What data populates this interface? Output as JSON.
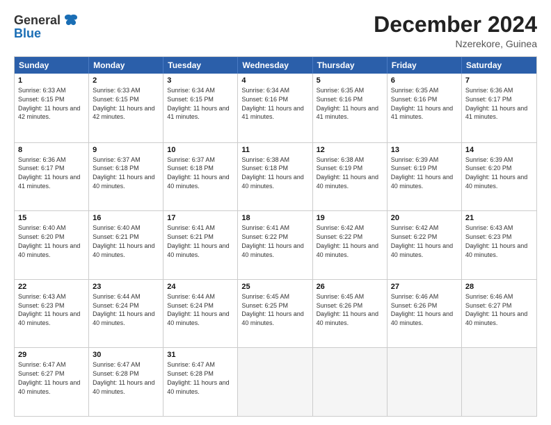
{
  "header": {
    "logo_general": "General",
    "logo_blue": "Blue",
    "month_title": "December 2024",
    "location": "Nzerekore, Guinea"
  },
  "weekdays": [
    "Sunday",
    "Monday",
    "Tuesday",
    "Wednesday",
    "Thursday",
    "Friday",
    "Saturday"
  ],
  "rows": [
    [
      {
        "day": "1",
        "sunrise": "Sunrise: 6:33 AM",
        "sunset": "Sunset: 6:15 PM",
        "daylight": "Daylight: 11 hours and 42 minutes."
      },
      {
        "day": "2",
        "sunrise": "Sunrise: 6:33 AM",
        "sunset": "Sunset: 6:15 PM",
        "daylight": "Daylight: 11 hours and 42 minutes."
      },
      {
        "day": "3",
        "sunrise": "Sunrise: 6:34 AM",
        "sunset": "Sunset: 6:15 PM",
        "daylight": "Daylight: 11 hours and 41 minutes."
      },
      {
        "day": "4",
        "sunrise": "Sunrise: 6:34 AM",
        "sunset": "Sunset: 6:16 PM",
        "daylight": "Daylight: 11 hours and 41 minutes."
      },
      {
        "day": "5",
        "sunrise": "Sunrise: 6:35 AM",
        "sunset": "Sunset: 6:16 PM",
        "daylight": "Daylight: 11 hours and 41 minutes."
      },
      {
        "day": "6",
        "sunrise": "Sunrise: 6:35 AM",
        "sunset": "Sunset: 6:16 PM",
        "daylight": "Daylight: 11 hours and 41 minutes."
      },
      {
        "day": "7",
        "sunrise": "Sunrise: 6:36 AM",
        "sunset": "Sunset: 6:17 PM",
        "daylight": "Daylight: 11 hours and 41 minutes."
      }
    ],
    [
      {
        "day": "8",
        "sunrise": "Sunrise: 6:36 AM",
        "sunset": "Sunset: 6:17 PM",
        "daylight": "Daylight: 11 hours and 41 minutes."
      },
      {
        "day": "9",
        "sunrise": "Sunrise: 6:37 AM",
        "sunset": "Sunset: 6:18 PM",
        "daylight": "Daylight: 11 hours and 40 minutes."
      },
      {
        "day": "10",
        "sunrise": "Sunrise: 6:37 AM",
        "sunset": "Sunset: 6:18 PM",
        "daylight": "Daylight: 11 hours and 40 minutes."
      },
      {
        "day": "11",
        "sunrise": "Sunrise: 6:38 AM",
        "sunset": "Sunset: 6:18 PM",
        "daylight": "Daylight: 11 hours and 40 minutes."
      },
      {
        "day": "12",
        "sunrise": "Sunrise: 6:38 AM",
        "sunset": "Sunset: 6:19 PM",
        "daylight": "Daylight: 11 hours and 40 minutes."
      },
      {
        "day": "13",
        "sunrise": "Sunrise: 6:39 AM",
        "sunset": "Sunset: 6:19 PM",
        "daylight": "Daylight: 11 hours and 40 minutes."
      },
      {
        "day": "14",
        "sunrise": "Sunrise: 6:39 AM",
        "sunset": "Sunset: 6:20 PM",
        "daylight": "Daylight: 11 hours and 40 minutes."
      }
    ],
    [
      {
        "day": "15",
        "sunrise": "Sunrise: 6:40 AM",
        "sunset": "Sunset: 6:20 PM",
        "daylight": "Daylight: 11 hours and 40 minutes."
      },
      {
        "day": "16",
        "sunrise": "Sunrise: 6:40 AM",
        "sunset": "Sunset: 6:21 PM",
        "daylight": "Daylight: 11 hours and 40 minutes."
      },
      {
        "day": "17",
        "sunrise": "Sunrise: 6:41 AM",
        "sunset": "Sunset: 6:21 PM",
        "daylight": "Daylight: 11 hours and 40 minutes."
      },
      {
        "day": "18",
        "sunrise": "Sunrise: 6:41 AM",
        "sunset": "Sunset: 6:22 PM",
        "daylight": "Daylight: 11 hours and 40 minutes."
      },
      {
        "day": "19",
        "sunrise": "Sunrise: 6:42 AM",
        "sunset": "Sunset: 6:22 PM",
        "daylight": "Daylight: 11 hours and 40 minutes."
      },
      {
        "day": "20",
        "sunrise": "Sunrise: 6:42 AM",
        "sunset": "Sunset: 6:22 PM",
        "daylight": "Daylight: 11 hours and 40 minutes."
      },
      {
        "day": "21",
        "sunrise": "Sunrise: 6:43 AM",
        "sunset": "Sunset: 6:23 PM",
        "daylight": "Daylight: 11 hours and 40 minutes."
      }
    ],
    [
      {
        "day": "22",
        "sunrise": "Sunrise: 6:43 AM",
        "sunset": "Sunset: 6:23 PM",
        "daylight": "Daylight: 11 hours and 40 minutes."
      },
      {
        "day": "23",
        "sunrise": "Sunrise: 6:44 AM",
        "sunset": "Sunset: 6:24 PM",
        "daylight": "Daylight: 11 hours and 40 minutes."
      },
      {
        "day": "24",
        "sunrise": "Sunrise: 6:44 AM",
        "sunset": "Sunset: 6:24 PM",
        "daylight": "Daylight: 11 hours and 40 minutes."
      },
      {
        "day": "25",
        "sunrise": "Sunrise: 6:45 AM",
        "sunset": "Sunset: 6:25 PM",
        "daylight": "Daylight: 11 hours and 40 minutes."
      },
      {
        "day": "26",
        "sunrise": "Sunrise: 6:45 AM",
        "sunset": "Sunset: 6:26 PM",
        "daylight": "Daylight: 11 hours and 40 minutes."
      },
      {
        "day": "27",
        "sunrise": "Sunrise: 6:46 AM",
        "sunset": "Sunset: 6:26 PM",
        "daylight": "Daylight: 11 hours and 40 minutes."
      },
      {
        "day": "28",
        "sunrise": "Sunrise: 6:46 AM",
        "sunset": "Sunset: 6:27 PM",
        "daylight": "Daylight: 11 hours and 40 minutes."
      }
    ],
    [
      {
        "day": "29",
        "sunrise": "Sunrise: 6:47 AM",
        "sunset": "Sunset: 6:27 PM",
        "daylight": "Daylight: 11 hours and 40 minutes."
      },
      {
        "day": "30",
        "sunrise": "Sunrise: 6:47 AM",
        "sunset": "Sunset: 6:28 PM",
        "daylight": "Daylight: 11 hours and 40 minutes."
      },
      {
        "day": "31",
        "sunrise": "Sunrise: 6:47 AM",
        "sunset": "Sunset: 6:28 PM",
        "daylight": "Daylight: 11 hours and 40 minutes."
      },
      {
        "day": "",
        "sunrise": "",
        "sunset": "",
        "daylight": ""
      },
      {
        "day": "",
        "sunrise": "",
        "sunset": "",
        "daylight": ""
      },
      {
        "day": "",
        "sunrise": "",
        "sunset": "",
        "daylight": ""
      },
      {
        "day": "",
        "sunrise": "",
        "sunset": "",
        "daylight": ""
      }
    ]
  ]
}
